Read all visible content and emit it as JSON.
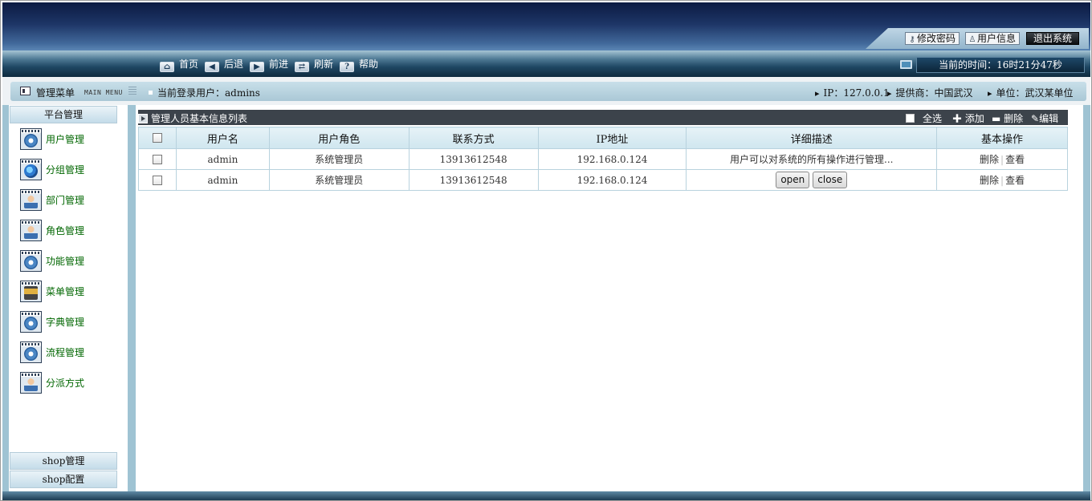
{
  "header": {
    "links": {
      "change_password": "修改密码",
      "user_info": "用户信息",
      "logout": "退出系统"
    }
  },
  "toolbar": {
    "home": "首页",
    "back": "后退",
    "forward": "前进",
    "refresh": "刷新",
    "help": "帮助",
    "time": "当前的时间：16时21分47秒"
  },
  "infobar": {
    "menu_title": "管理菜单",
    "menu_sub": "MAIN MENU",
    "login_user": "当前登录用户：admins",
    "ip": "IP：127.0.0.1",
    "provider": "提供商：中国武汉",
    "unit": "单位：武汉某单位"
  },
  "sidebar": {
    "section_top": "平台管理",
    "items": [
      {
        "label": "用户管理",
        "icon": "gear-icon"
      },
      {
        "label": "分组管理",
        "icon": "globe-icon"
      },
      {
        "label": "部门管理",
        "icon": "person-icon"
      },
      {
        "label": "角色管理",
        "icon": "person-icon"
      },
      {
        "label": "功能管理",
        "icon": "gear-icon"
      },
      {
        "label": "菜单管理",
        "icon": "menu-icon"
      },
      {
        "label": "字典管理",
        "icon": "gear-icon"
      },
      {
        "label": "流程管理",
        "icon": "gear-icon"
      },
      {
        "label": "分派方式",
        "icon": "person-icon"
      }
    ],
    "section_bottom_1": "shop管理",
    "section_bottom_2": "shop配置"
  },
  "panel": {
    "title": "管理人员基本信息列表",
    "select_all": "全选",
    "add": "添加",
    "delete": "删除",
    "edit": "编辑"
  },
  "table": {
    "headers": [
      "用户名",
      "用户角色",
      "联系方式",
      "IP地址",
      "详细描述",
      "基本操作"
    ],
    "rows": [
      {
        "username": "admin",
        "role": "系统管理员",
        "contact": "13913612548",
        "ip": "192.168.0.124",
        "desc": "用户可以对系统的所有操作进行管理..."
      },
      {
        "username": "admin",
        "role": "系统管理员",
        "contact": "13913612548",
        "ip": "192.168.0.124",
        "desc": ""
      }
    ],
    "op_delete": "删除",
    "op_view": "查看",
    "btn_open": "open",
    "btn_close": "close"
  }
}
